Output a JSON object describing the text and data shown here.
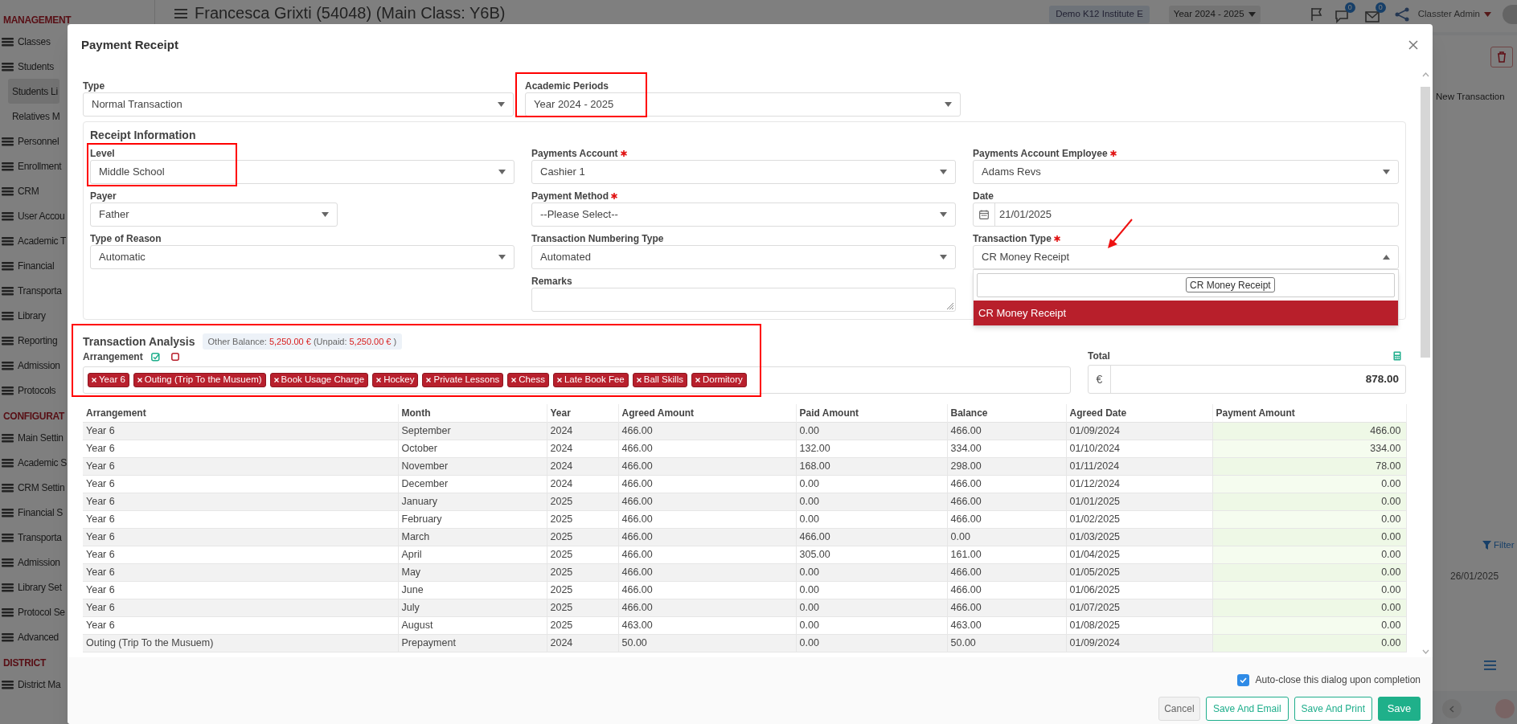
{
  "sidebar": {
    "sections": [
      {
        "title": "MANAGEMENT",
        "items": [
          {
            "label": "Classes",
            "selected": false
          },
          {
            "label": "Students",
            "selected": false,
            "children": [
              {
                "label": "Students Li",
                "selected": true
              },
              {
                "label": "Relatives M",
                "selected": false
              }
            ]
          },
          {
            "label": "Personnel",
            "selected": false
          },
          {
            "label": "Enrollment",
            "selected": false
          },
          {
            "label": "CRM",
            "selected": false
          },
          {
            "label": "User Accou",
            "selected": false
          },
          {
            "label": "Academic T",
            "selected": false
          },
          {
            "label": "Financial",
            "selected": false
          },
          {
            "label": "Transporta",
            "selected": false
          },
          {
            "label": "Library",
            "selected": false
          },
          {
            "label": "Reporting",
            "selected": false
          },
          {
            "label": "Admission",
            "selected": false
          },
          {
            "label": "Protocols",
            "selected": false
          }
        ]
      },
      {
        "title": "CONFIGURAT",
        "items": [
          {
            "label": "Main Settin",
            "selected": false
          },
          {
            "label": "Academic S",
            "selected": false
          },
          {
            "label": "CRM Settin",
            "selected": false
          },
          {
            "label": "Financial S",
            "selected": false
          },
          {
            "label": "Transporta",
            "selected": false
          },
          {
            "label": "Admission",
            "selected": false
          },
          {
            "label": "Library Set",
            "selected": false
          },
          {
            "label": "Protocol Se",
            "selected": false
          },
          {
            "label": "Advanced",
            "selected": false
          }
        ]
      },
      {
        "title": "DISTRICT",
        "items": [
          {
            "label": "District Ma",
            "selected": false
          }
        ]
      }
    ]
  },
  "header": {
    "title": "Francesca Grixti (54048) (Main Class: Y6B)",
    "institute": "Demo K12 Institute E",
    "year": "Year 2024 - 2025",
    "badges": [
      "0",
      "0"
    ],
    "user": "Classter Admin"
  },
  "background": {
    "new_transaction": "New Transaction",
    "filter": "Filter",
    "date": "26/01/2025"
  },
  "dialog": {
    "title": "Payment Receipt",
    "top_fields": [
      {
        "label": "Type",
        "value": "Normal Transaction",
        "kind": "select",
        "required": false
      },
      {
        "label": "Academic Periods",
        "value": "Year 2024 - 2025",
        "kind": "select",
        "required": false
      }
    ],
    "receipt_information": {
      "title": "Receipt Information",
      "columns": [
        [
          {
            "label": "Level",
            "value": "Middle School",
            "kind": "select",
            "required": false
          },
          {
            "label": "Payer",
            "value": "Father",
            "kind": "short_select",
            "required": false
          },
          {
            "label": "Type of Reason",
            "value": "Automatic",
            "kind": "select",
            "required": false
          }
        ],
        [
          {
            "label": "Payments Account",
            "value": "Cashier 1",
            "kind": "select",
            "required": true
          },
          {
            "label": "Payment Method",
            "value": "--Please Select--",
            "kind": "select",
            "required": true
          },
          {
            "label": "Transaction Numbering Type",
            "value": "Automated",
            "kind": "select",
            "required": false
          },
          {
            "label": "Remarks",
            "kind": "textarea",
            "required": false
          }
        ],
        [
          {
            "label": "Payments Account Employee",
            "value": "Adams Revs",
            "kind": "select",
            "required": true
          },
          {
            "label": "Date",
            "value": "21/01/2025",
            "kind": "date",
            "required": false
          },
          {
            "label": "Transaction Type",
            "value": "CR Money Receipt",
            "kind": "select",
            "required": true,
            "open": true,
            "options": [
              {
                "label": "CR Money Receipt",
                "selected": true
              }
            ],
            "tooltip": "CR Money Receipt"
          }
        ]
      ]
    },
    "transaction_analysis": {
      "title": "Transaction Analysis",
      "balance": [
        {
          "text": "Other Balance:",
          "kind": "label"
        },
        {
          "text": "5,250.00 €",
          "kind": "amount"
        },
        {
          "text": "(Unpaid:",
          "kind": "label"
        },
        {
          "text": "5,250.00 €",
          "kind": "amount"
        },
        {
          "text": ")",
          "kind": "label"
        }
      ],
      "arrangement_label": "Arrangement",
      "tags": [
        "Year 6",
        "Outing (Trip To the Musuem)",
        "Book Usage Charge",
        "Hockey",
        "Private Lessons",
        "Chess",
        "Late Book Fee",
        "Ball Skills",
        "Dormitory"
      ],
      "total": {
        "label": "Total",
        "currency": "€",
        "value": "878.00"
      }
    },
    "table": {
      "columns": [
        "Arrangement",
        "Month",
        "Year",
        "Agreed Amount",
        "Paid Amount",
        "Balance",
        "Agreed Date",
        "Payment Amount"
      ],
      "rows": [
        [
          "Year 6",
          "September",
          "2024",
          "466.00",
          "0.00",
          "466.00",
          "01/09/2024",
          "466.00"
        ],
        [
          "Year 6",
          "October",
          "2024",
          "466.00",
          "132.00",
          "334.00",
          "01/10/2024",
          "334.00"
        ],
        [
          "Year 6",
          "November",
          "2024",
          "466.00",
          "168.00",
          "298.00",
          "01/11/2024",
          "78.00"
        ],
        [
          "Year 6",
          "December",
          "2024",
          "466.00",
          "0.00",
          "466.00",
          "01/12/2024",
          "0.00"
        ],
        [
          "Year 6",
          "January",
          "2025",
          "466.00",
          "0.00",
          "466.00",
          "01/01/2025",
          "0.00"
        ],
        [
          "Year 6",
          "February",
          "2025",
          "466.00",
          "0.00",
          "466.00",
          "01/02/2025",
          "0.00"
        ],
        [
          "Year 6",
          "March",
          "2025",
          "466.00",
          "466.00",
          "0.00",
          "01/03/2025",
          "0.00"
        ],
        [
          "Year 6",
          "April",
          "2025",
          "466.00",
          "305.00",
          "161.00",
          "01/04/2025",
          "0.00"
        ],
        [
          "Year 6",
          "May",
          "2025",
          "466.00",
          "0.00",
          "466.00",
          "01/05/2025",
          "0.00"
        ],
        [
          "Year 6",
          "June",
          "2025",
          "466.00",
          "0.00",
          "466.00",
          "01/06/2025",
          "0.00"
        ],
        [
          "Year 6",
          "July",
          "2025",
          "466.00",
          "0.00",
          "466.00",
          "01/07/2025",
          "0.00"
        ],
        [
          "Year 6",
          "August",
          "2025",
          "463.00",
          "0.00",
          "463.00",
          "01/08/2025",
          "0.00"
        ],
        [
          "Outing (Trip To the Musuem)",
          "Prepayment",
          "2024",
          "50.00",
          "0.00",
          "50.00",
          "01/09/2024",
          "0.00"
        ]
      ]
    },
    "auto_close": {
      "label": "Auto-close this dialog upon completion",
      "checked": true
    },
    "buttons": [
      {
        "label": "Cancel",
        "kind": "cancel"
      },
      {
        "label": "Save And Email",
        "kind": "outline"
      },
      {
        "label": "Save And Print",
        "kind": "outline"
      },
      {
        "label": "Save",
        "kind": "primary"
      }
    ]
  }
}
